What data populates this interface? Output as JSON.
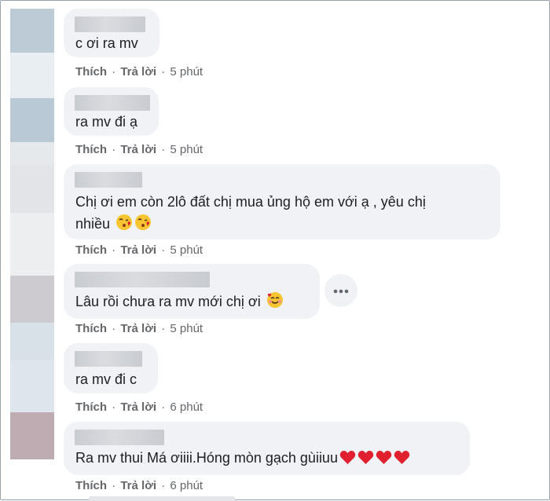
{
  "actions": {
    "like": "Thích",
    "reply": "Trả lời",
    "separator": "·"
  },
  "colors": {
    "bubble": "#f0f2f5",
    "meta_text": "#65676b",
    "avatar_blur_1": "#b8c9d6",
    "avatar_blur_2": "#dde1e5",
    "avatar_blur_3": "#b9a7ae",
    "heart": "#e0202f"
  },
  "comments": [
    {
      "text": "c ơi ra mv",
      "time": "5 phút",
      "emoji": []
    },
    {
      "text": "ra mv đi ạ",
      "time": "5 phút",
      "emoji": []
    },
    {
      "text": "Chị ơi em còn 2lô đất chị mua ủng hộ em với ạ , yêu chị",
      "text_line2": "nhiều",
      "time": "5 phút",
      "emoji": [
        "face-blowing-kiss",
        "face-blowing-kiss"
      ]
    },
    {
      "text": "Lâu rồi chưa ra mv mới chị ơi",
      "time": "5 phút",
      "emoji": [
        "smiling-face-with-hearts"
      ]
    },
    {
      "text": "ra mv đi c",
      "time": "6 phút",
      "emoji": []
    },
    {
      "text": "Ra mv thui Má ơiiii.Hóng mòn gạch gùiiuu",
      "time": "6 phút",
      "emoji": [
        "red-heart",
        "red-heart",
        "red-heart",
        "red-heart"
      ]
    }
  ],
  "more_button_icon": "more-horizontal-icon"
}
